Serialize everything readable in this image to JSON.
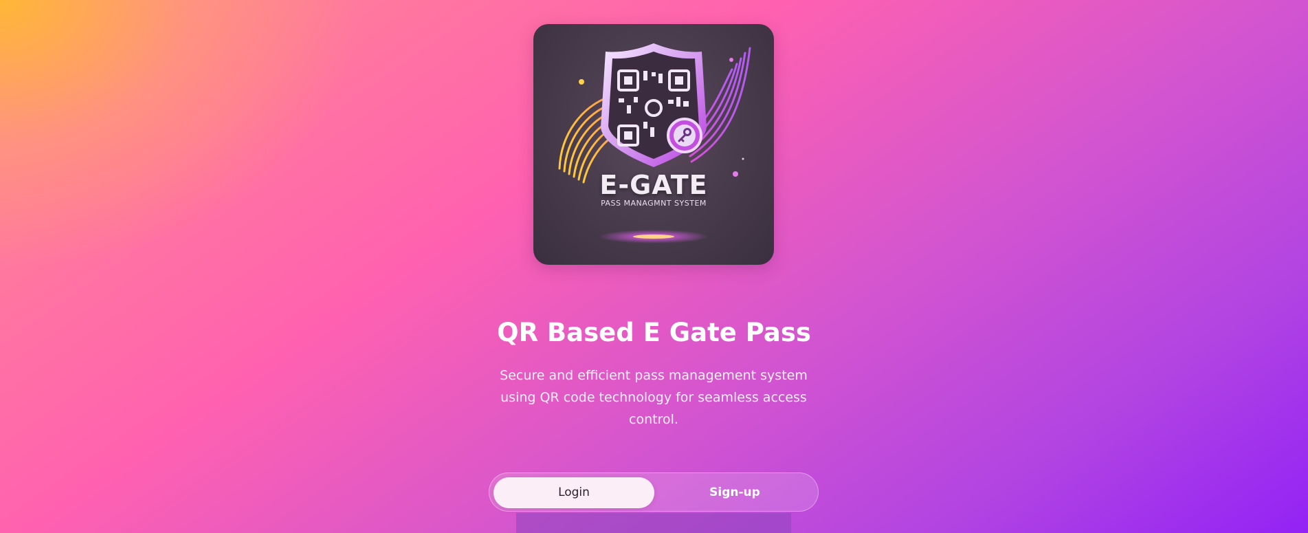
{
  "logo": {
    "brand_name": "E-GATE",
    "tagline": "PASS MANAGMNT SYSTEM",
    "icon": "qr-shield-key-icon"
  },
  "hero": {
    "title": "QR Based E Gate Pass",
    "description": "Secure and efficient pass management system using QR code technology for seamless access control."
  },
  "auth_toggle": {
    "login_label": "Login",
    "signup_label": "Sign-up",
    "active": "Login"
  },
  "colors": {
    "background_start": "#ffb933",
    "background_mid": "#ff61b0",
    "background_end": "#9322f5",
    "active_tab": "#fbeef7"
  }
}
